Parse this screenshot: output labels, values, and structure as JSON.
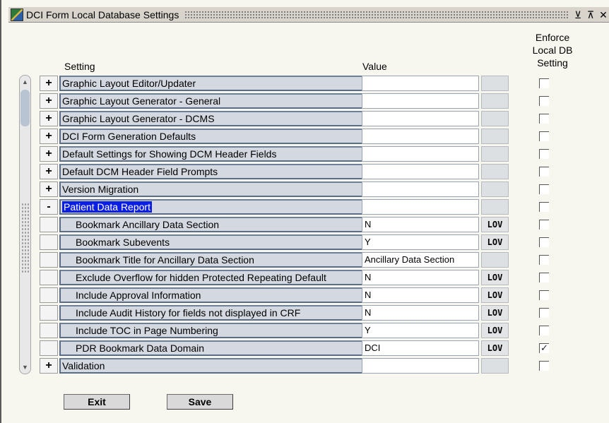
{
  "window": {
    "title": "DCI Form Local Database Settings",
    "min_label": "⊻",
    "max_label": "⊼",
    "close_label": "✕"
  },
  "headers": {
    "setting": "Setting",
    "value": "Value",
    "enforce": [
      "Enforce",
      "Local DB",
      "Setting"
    ]
  },
  "rows": [
    {
      "toggle": "+",
      "label": "Graphic Layout Editor/Updater",
      "value": "",
      "lov": "",
      "checked": false
    },
    {
      "toggle": "+",
      "label": "Graphic Layout Generator - General",
      "value": "",
      "lov": "",
      "checked": false
    },
    {
      "toggle": "+",
      "label": "Graphic Layout Generator - DCMS",
      "value": "",
      "lov": "",
      "checked": false
    },
    {
      "toggle": "+",
      "label": "DCI Form Generation Defaults",
      "value": "",
      "lov": "",
      "checked": false
    },
    {
      "toggle": "+",
      "label": "Default Settings for Showing DCM Header Fields",
      "value": "",
      "lov": "",
      "checked": false
    },
    {
      "toggle": "+",
      "label": "Default DCM Header Field Prompts",
      "value": "",
      "lov": "",
      "checked": false
    },
    {
      "toggle": "+",
      "label": "Version Migration",
      "value": "",
      "lov": "",
      "checked": false
    },
    {
      "toggle": "-",
      "label": "Patient Data Report",
      "value": "",
      "lov": "",
      "checked": false
    },
    {
      "toggle": "",
      "label": "Bookmark Ancillary Data Section",
      "value": "N",
      "lov": "LOV",
      "checked": false
    },
    {
      "toggle": "",
      "label": "Bookmark Subevents",
      "value": "Y",
      "lov": "LOV",
      "checked": false
    },
    {
      "toggle": "",
      "label": "Bookmark Title for Ancillary Data Section",
      "value": "Ancillary Data Section",
      "lov": "",
      "checked": false
    },
    {
      "toggle": "",
      "label": "Exclude Overflow for hidden Protected Repeating Default",
      "value": "N",
      "lov": "LOV",
      "checked": false
    },
    {
      "toggle": "",
      "label": "Include Approval Information",
      "value": "N",
      "lov": "LOV",
      "checked": false
    },
    {
      "toggle": "",
      "label": "Include Audit History for fields not displayed in CRF",
      "value": "N",
      "lov": "LOV",
      "checked": false
    },
    {
      "toggle": "",
      "label": "Include TOC in Page Numbering",
      "value": "Y",
      "lov": "LOV",
      "checked": false
    },
    {
      "toggle": "",
      "label": "PDR Bookmark Data Domain",
      "value": "DCI",
      "lov": "LOV",
      "checked": true
    },
    {
      "toggle": "+",
      "label": "Validation",
      "value": "",
      "lov": "",
      "checked": false
    }
  ],
  "buttons": {
    "exit": "Exit",
    "save": "Save"
  },
  "icons": {
    "app": "app-icon",
    "scroll_up": "scroll-up-icon",
    "scroll_down": "scroll-down-icon",
    "check": "checkmark-icon"
  }
}
